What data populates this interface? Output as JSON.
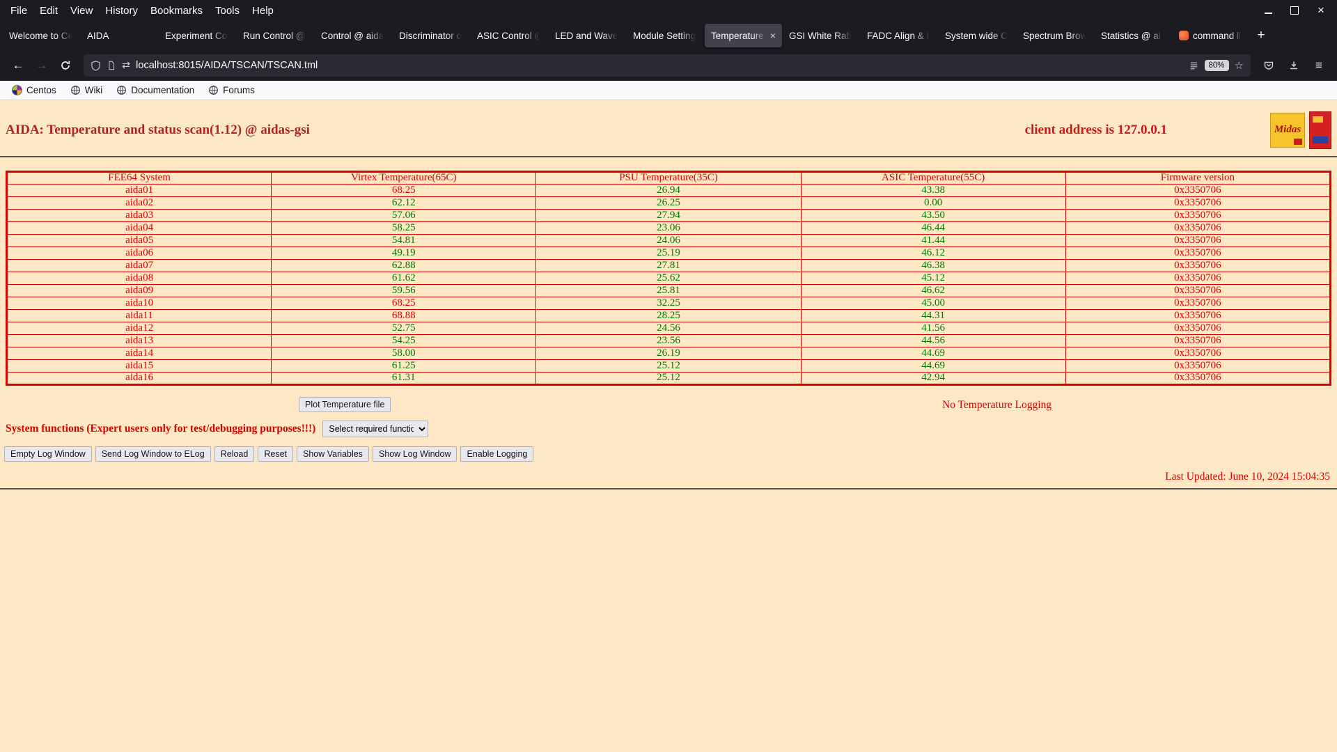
{
  "icons": {
    "back": "←",
    "forward": "→",
    "arrows": "⇄",
    "star": "☆",
    "menu": "≡",
    "new_tab": "+",
    "close_tab": "×"
  },
  "colors": {
    "page_background": "#fde8c6",
    "alert_red": "#dd0000",
    "ok_green": "#007800",
    "title_red": "#b22222"
  },
  "browser": {
    "menu_items": [
      "File",
      "Edit",
      "View",
      "History",
      "Bookmarks",
      "Tools",
      "Help"
    ],
    "tabs": [
      {
        "label": "Welcome to Ce"
      },
      {
        "label": "AIDA"
      },
      {
        "label": "Experiment Co"
      },
      {
        "label": "Run Control @"
      },
      {
        "label": "Control @ aida"
      },
      {
        "label": "Discriminator c"
      },
      {
        "label": "ASIC Control @"
      },
      {
        "label": "LED and Wavef"
      },
      {
        "label": "Module Setting"
      },
      {
        "label": "Temperature",
        "active": true
      },
      {
        "label": "GSI White Rab"
      },
      {
        "label": "FADC Align & L"
      },
      {
        "label": "System wide C"
      },
      {
        "label": "Spectrum Brow"
      },
      {
        "label": "Statistics @ ai"
      },
      {
        "label": "command li",
        "favicon": "terminal"
      }
    ],
    "nav": {
      "url": "localhost:8015/AIDA/TSCAN/TSCAN.tml",
      "zoom": "80%"
    },
    "bookmarks": [
      {
        "label": "Centos",
        "icon": "centos-icon"
      },
      {
        "label": "Wiki",
        "icon": "globe-icon"
      },
      {
        "label": "Documentation",
        "icon": "globe-icon"
      },
      {
        "label": "Forums",
        "icon": "globe-icon"
      }
    ]
  },
  "page": {
    "title": "AIDA: Temperature and status scan(1.12) @ aidas-gsi",
    "client_address": "client address is 127.0.0.1",
    "midas_logo_text": "Midas",
    "table": {
      "headers": [
        "FEE64 System",
        "Virtex Temperature(65C)",
        "PSU Temperature(35C)",
        "ASIC Temperature(55C)",
        "Firmware version"
      ],
      "thresholds": [
        65,
        35,
        55
      ],
      "rows": [
        {
          "name": "aida01",
          "virtex": "68.25",
          "psu": "26.94",
          "asic": "43.38",
          "firmware": "0x3350706"
        },
        {
          "name": "aida02",
          "virtex": "62.12",
          "psu": "26.25",
          "asic": "0.00",
          "firmware": "0x3350706"
        },
        {
          "name": "aida03",
          "virtex": "57.06",
          "psu": "27.94",
          "asic": "43.50",
          "firmware": "0x3350706"
        },
        {
          "name": "aida04",
          "virtex": "58.25",
          "psu": "23.06",
          "asic": "46.44",
          "firmware": "0x3350706"
        },
        {
          "name": "aida05",
          "virtex": "54.81",
          "psu": "24.06",
          "asic": "41.44",
          "firmware": "0x3350706"
        },
        {
          "name": "aida06",
          "virtex": "49.19",
          "psu": "25.19",
          "asic": "46.12",
          "firmware": "0x3350706"
        },
        {
          "name": "aida07",
          "virtex": "62.88",
          "psu": "27.81",
          "asic": "46.38",
          "firmware": "0x3350706"
        },
        {
          "name": "aida08",
          "virtex": "61.62",
          "psu": "25.62",
          "asic": "45.12",
          "firmware": "0x3350706"
        },
        {
          "name": "aida09",
          "virtex": "59.56",
          "psu": "25.81",
          "asic": "46.62",
          "firmware": "0x3350706"
        },
        {
          "name": "aida10",
          "virtex": "68.25",
          "psu": "32.25",
          "asic": "45.00",
          "firmware": "0x3350706"
        },
        {
          "name": "aida11",
          "virtex": "68.88",
          "psu": "28.25",
          "asic": "44.31",
          "firmware": "0x3350706"
        },
        {
          "name": "aida12",
          "virtex": "52.75",
          "psu": "24.56",
          "asic": "41.56",
          "firmware": "0x3350706"
        },
        {
          "name": "aida13",
          "virtex": "54.25",
          "psu": "23.56",
          "asic": "44.56",
          "firmware": "0x3350706"
        },
        {
          "name": "aida14",
          "virtex": "58.00",
          "psu": "26.19",
          "asic": "44.69",
          "firmware": "0x3350706"
        },
        {
          "name": "aida15",
          "virtex": "61.25",
          "psu": "25.12",
          "asic": "44.69",
          "firmware": "0x3350706"
        },
        {
          "name": "aida16",
          "virtex": "61.31",
          "psu": "25.12",
          "asic": "42.94",
          "firmware": "0x3350706"
        }
      ]
    },
    "plot_button": "Plot Temperature file",
    "logging_status": "No Temperature Logging",
    "system_functions_label": "System functions (Expert users only for test/debugging purposes!!!)",
    "function_select_value": "Select required function",
    "action_buttons": [
      "Empty Log Window",
      "Send Log Window to ELog",
      "Reload",
      "Reset",
      "Show Variables",
      "Show Log Window",
      "Enable Logging"
    ],
    "last_updated": "Last Updated: June 10, 2024 15:04:35"
  }
}
